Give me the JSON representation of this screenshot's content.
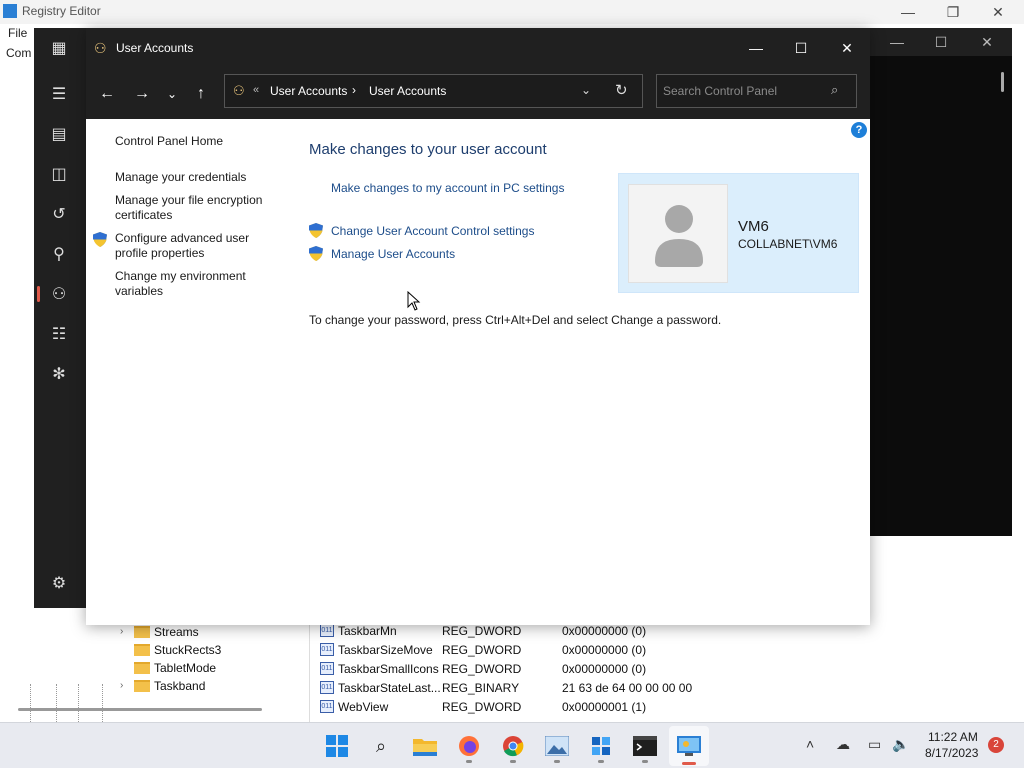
{
  "registry_editor": {
    "title": "Registry Editor",
    "menu_file": "File",
    "address_label": "Com",
    "tree_items": [
      {
        "label": "Streams",
        "expandable": true
      },
      {
        "label": "StuckRects3",
        "expandable": false
      },
      {
        "label": "TabletMode",
        "expandable": false
      },
      {
        "label": "Taskband",
        "expandable": true
      }
    ],
    "values": [
      {
        "name": "TaskbarMn",
        "type": "REG_DWORD",
        "data": "0x00000000 (0)"
      },
      {
        "name": "TaskbarSizeMove",
        "type": "REG_DWORD",
        "data": "0x00000000 (0)"
      },
      {
        "name": "TaskbarSmallIcons",
        "type": "REG_DWORD",
        "data": "0x00000000 (0)"
      },
      {
        "name": "TaskbarStateLast...",
        "type": "REG_BINARY",
        "data": "21 63 de 64 00 00 00 00"
      },
      {
        "name": "WebView",
        "type": "REG_DWORD",
        "data": "0x00000001 (1)"
      }
    ]
  },
  "user_accounts": {
    "title": "User Accounts",
    "breadcrumb": [
      "User Accounts",
      "User Accounts"
    ],
    "search_placeholder": "Search Control Panel",
    "left_nav": {
      "home": "Control Panel Home",
      "manage_credentials": "Manage your credentials",
      "file_encryption": "Manage your file encryption certificates",
      "advanced_profile": "Configure advanced user profile properties",
      "environment_vars": "Change my environment variables"
    },
    "main": {
      "heading": "Make changes to your user account",
      "pc_settings_link": "Make changes to my account in PC settings",
      "uac_link": "Change User Account Control settings",
      "manage_accounts_link": "Manage User Accounts",
      "password_note": "To change your password, press Ctrl+Alt+Del and select Change a password."
    },
    "user": {
      "name": "VM6",
      "domain": "COLLABNET\\VM6"
    },
    "help": "?"
  },
  "taskbar": {
    "time": "11:22 AM",
    "date": "8/17/2023",
    "notification_count": "2"
  },
  "colors": {
    "accent": "#1e7fd8",
    "link": "#1d4d8a",
    "heading": "#1e3e6e",
    "user_card": "#dbeefc",
    "titlebar": "#202020"
  }
}
